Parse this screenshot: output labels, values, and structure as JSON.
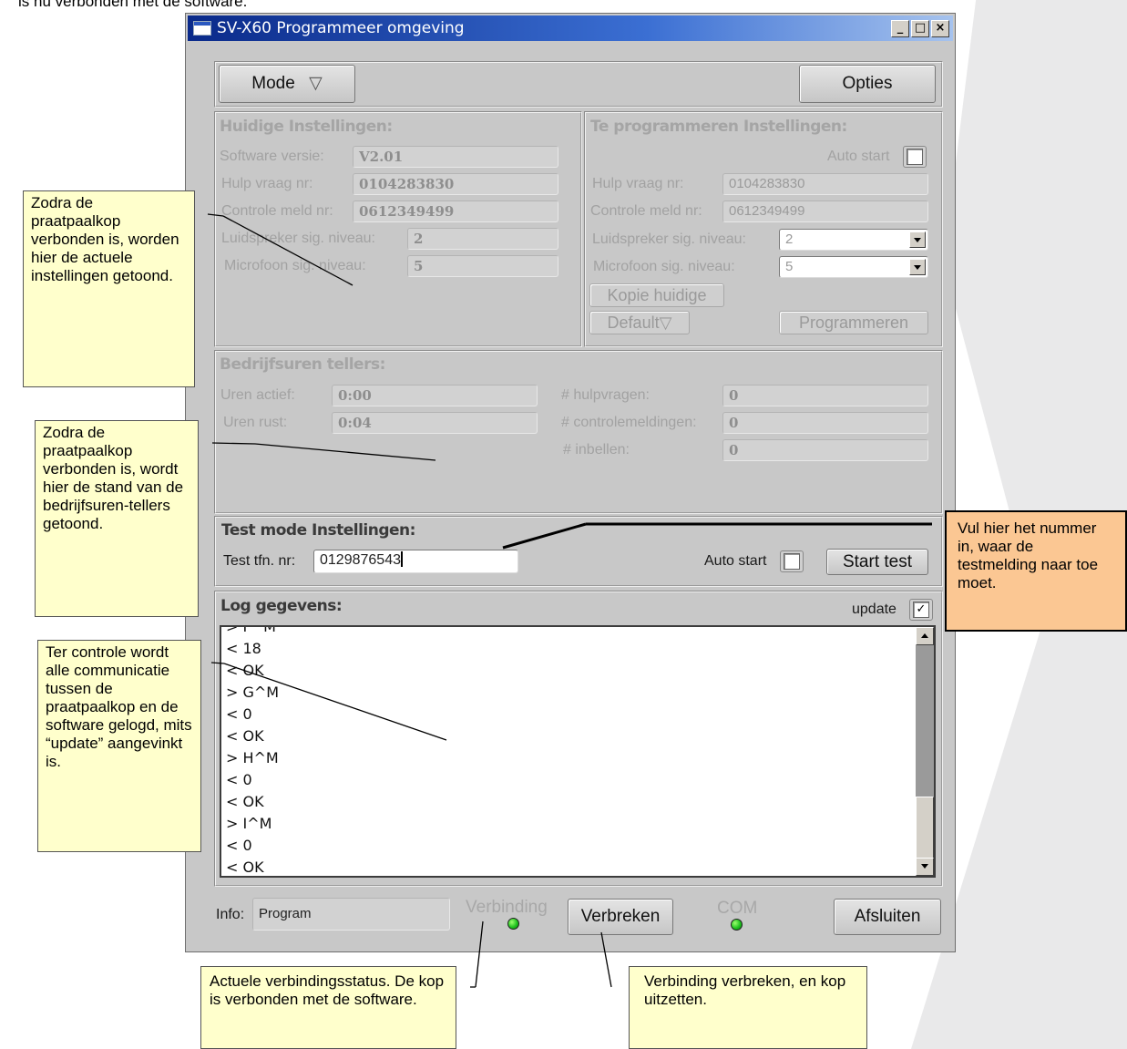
{
  "top_text": "is nu verbonden met de software.",
  "window": {
    "title": "SV-X60 Programmeer omgeving",
    "controls": {
      "minimize": "_",
      "maximize": "□",
      "close": "×"
    }
  },
  "toolbar": {
    "mode_label": "Mode",
    "mode_arrow": "▽",
    "options_label": "Opties"
  },
  "current_settings": {
    "title": "Huidige Instellingen:",
    "software_version_label": "Software versie:",
    "software_version_value": "V2.01",
    "help_nr_label": "Hulp vraag nr:",
    "help_nr_value": "0104283830",
    "control_nr_label": "Controle meld nr:",
    "control_nr_value": "0612349499",
    "speaker_label": "Luidspreker sig. niveau:",
    "speaker_value": "2",
    "mic_label": "Microfoon sig. niveau:",
    "mic_value": "5"
  },
  "program_settings": {
    "title": "Te programmeren Instellingen:",
    "auto_start_label": "Auto start",
    "help_nr_label": "Hulp vraag nr:",
    "help_nr_value": "0104283830",
    "control_nr_label": "Controle meld nr:",
    "control_nr_value": "0612349499",
    "speaker_label": "Luidspreker sig. niveau:",
    "speaker_value": "2",
    "mic_label": "Microfoon sig. niveau:",
    "mic_value": "5",
    "copy_button": "Kopie huidige",
    "default_button": "Default",
    "default_arrow": "▽",
    "program_button": "Programmeren"
  },
  "counters": {
    "title": "Bedrijfsuren tellers:",
    "hours_active_label": "Uren actief:",
    "hours_active_value": "0:00",
    "hours_rest_label": "Uren rust:",
    "hours_rest_value": "0:04",
    "help_requests_label": "# hulpvragen:",
    "help_requests_value": "0",
    "control_msgs_label": "# controlemeldingen:",
    "control_msgs_value": "0",
    "dialins_label": "# inbellen:",
    "dialins_value": "0"
  },
  "test_mode": {
    "title": "Test mode Instellingen:",
    "phone_label": "Test tfn. nr:",
    "phone_value": "0129876543",
    "auto_start_label": "Auto start",
    "start_button": "Start test"
  },
  "log": {
    "title": "Log gegevens:",
    "update_label": "update",
    "update_check": "✓",
    "lines": [
      "> F^M",
      "< 18",
      "< OK",
      "> G^M",
      "< 0",
      "< OK",
      "> H^M",
      "< 0",
      "< OK",
      "> I^M",
      "< 0",
      "< OK"
    ]
  },
  "status_bar": {
    "info_label": "Info:",
    "info_value": "Program",
    "connection_label": "Verbinding",
    "disconnect_button": "Verbreken",
    "com_label": "COM",
    "close_button": "Afsluiten"
  },
  "annotations": {
    "note1": "Zodra de praatpaalkop verbonden is, worden hier de actuele instellingen getoond.",
    "note2": "Zodra de praatpaalkop verbonden is, wordt hier de stand van de bedrijfsuren-tellers getoond.",
    "note3": "Ter controle wordt alle communicatie tussen de praatpaalkop en de software gelogd, mits “update” aangevinkt is.",
    "note4": "Vul hier het nummer in, waar de testmelding naar toe moet.",
    "note5": "Actuele verbindingsstatus. De kop is verbonden met de software.",
    "note6": "Verbinding verbreken, en kop uitzetten."
  },
  "colors": {
    "led_green": "#1fc21f",
    "note_yellow": "#ffffcc",
    "note_orange": "#fbc793",
    "title_blue": "#0a2a8a"
  }
}
